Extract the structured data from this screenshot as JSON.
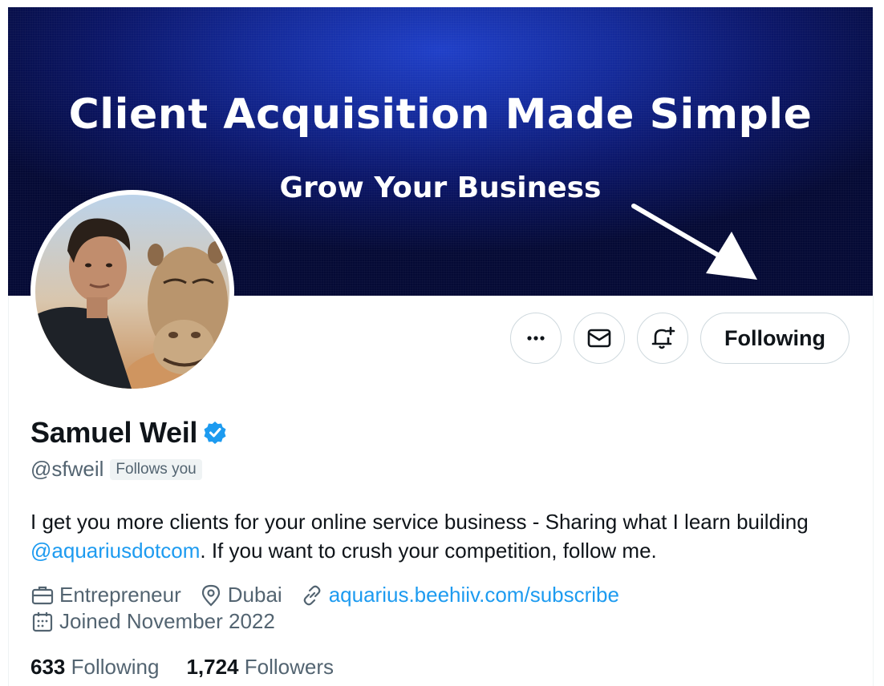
{
  "banner": {
    "title": "Client Acquisition Made Simple",
    "subtitle": "Grow Your Business"
  },
  "actions": {
    "more_icon": "more-horizontal-icon",
    "message_icon": "envelope-icon",
    "notify_icon": "bell-plus-icon",
    "following_label": "Following"
  },
  "profile": {
    "name": "Samuel Weil",
    "verified_icon": "verified-badge-icon",
    "handle": "@sfweil",
    "follows_you": "Follows you",
    "bio_part1": "I get you more clients for your online service business - Sharing what I learn building ",
    "bio_mention": "@aquariusdotcom",
    "bio_part2": ". If you want to crush your competition, follow me.",
    "category": "Entrepreneur",
    "location": "Dubai",
    "website": "aquarius.beehiiv.com/subscribe",
    "joined": "Joined November 2022"
  },
  "stats": {
    "following_count": "633",
    "following_label": "Following",
    "followers_count": "1,724",
    "followers_label": "Followers"
  },
  "colors": {
    "link": "#1d9bf0",
    "secondary_text": "#536471",
    "primary_text": "#0f1419",
    "banner": "#0b1668"
  }
}
